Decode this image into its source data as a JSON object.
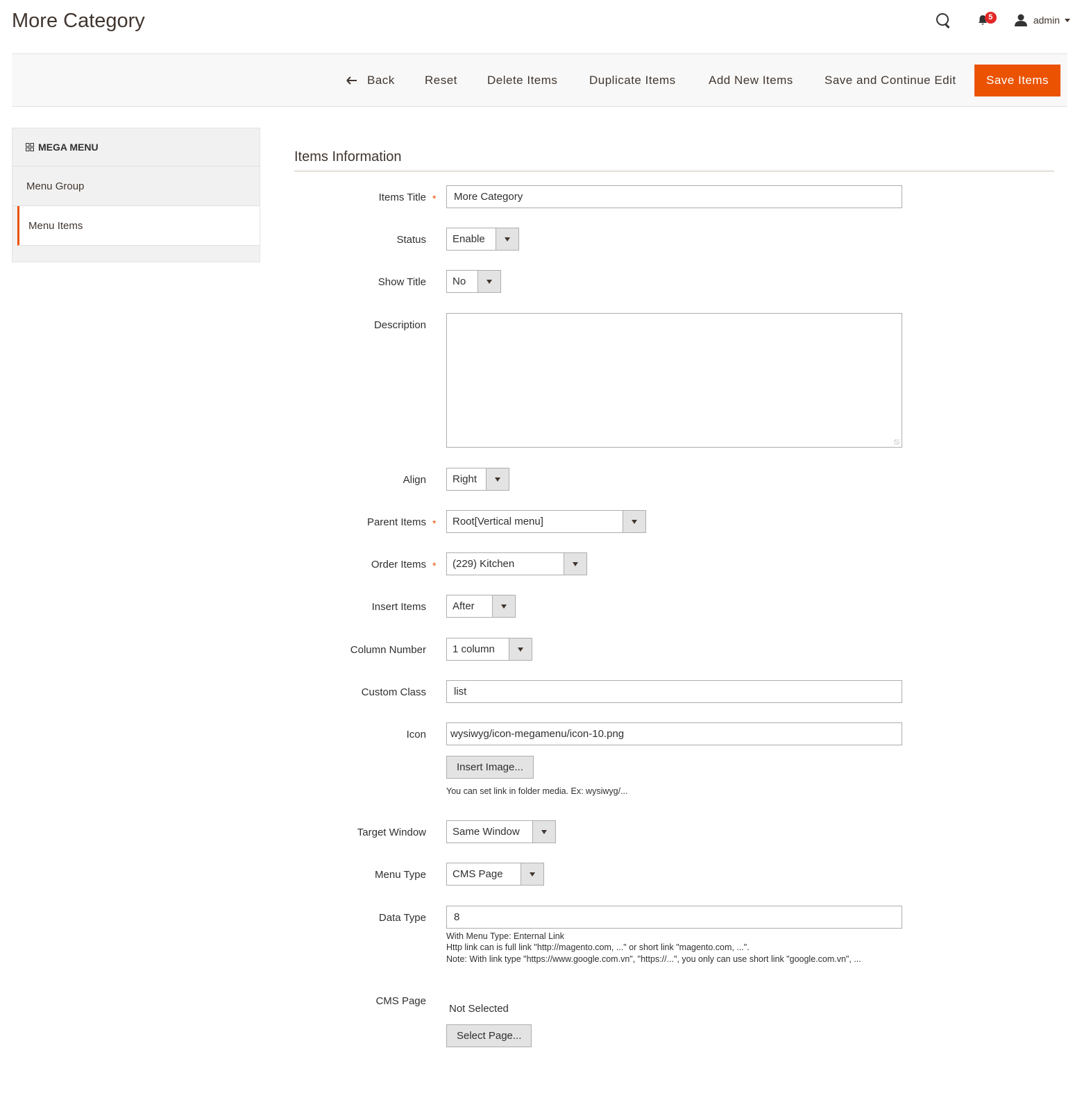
{
  "page": {
    "title": "More Category"
  },
  "header": {
    "notification_count": "5",
    "user_name": "admin"
  },
  "actions": {
    "back": "Back",
    "reset": "Reset",
    "delete": "Delete Items",
    "duplicate": "Duplicate Items",
    "add_new": "Add New Items",
    "save_continue": "Save and Continue Edit",
    "save": "Save Items"
  },
  "sidebar": {
    "header": "MEGA MENU",
    "items": [
      {
        "label": "Menu Group"
      },
      {
        "label": "Menu Items"
      }
    ]
  },
  "form": {
    "section_title": "Items Information",
    "required_mark": "*",
    "items_title": {
      "label": "Items Title",
      "value": "More Category"
    },
    "status": {
      "label": "Status",
      "value": "Enable"
    },
    "show_title": {
      "label": "Show Title",
      "value": "No"
    },
    "description": {
      "label": "Description",
      "value": ""
    },
    "align": {
      "label": "Align",
      "value": "Right"
    },
    "parent_items": {
      "label": "Parent Items",
      "value": "Root[Vertical menu]"
    },
    "order_items": {
      "label": "Order Items",
      "value": "(229) Kitchen"
    },
    "insert_items": {
      "label": "Insert Items",
      "value": "After"
    },
    "column_number": {
      "label": "Column Number",
      "value": "1 column"
    },
    "custom_class": {
      "label": "Custom Class",
      "value": "list"
    },
    "icon": {
      "label": "Icon",
      "value": "wysiwyg/icon-megamenu/icon-10.png",
      "button": "Insert Image...",
      "note": "You can set link in folder media. Ex: wysiwyg/..."
    },
    "target_window": {
      "label": "Target Window",
      "value": "Same Window"
    },
    "menu_type": {
      "label": "Menu Type",
      "value": "CMS Page"
    },
    "data_type": {
      "label": "Data Type",
      "value": "8",
      "note_lines": [
        "With Menu Type: Enternal Link",
        "Http link can is full link \"http://magento.com, ...\" or short link \"magento.com, ...\".",
        "Note: With link type \"https://www.google.com.vn\", \"https://...\", you only can use short link \"google.com.vn\", ..."
      ]
    },
    "cms_page": {
      "label": "CMS Page",
      "value": "Not Selected",
      "button": "Select Page..."
    }
  },
  "colors": {
    "accent": "#eb5202",
    "badge": "#e22626",
    "text": "#303030"
  }
}
